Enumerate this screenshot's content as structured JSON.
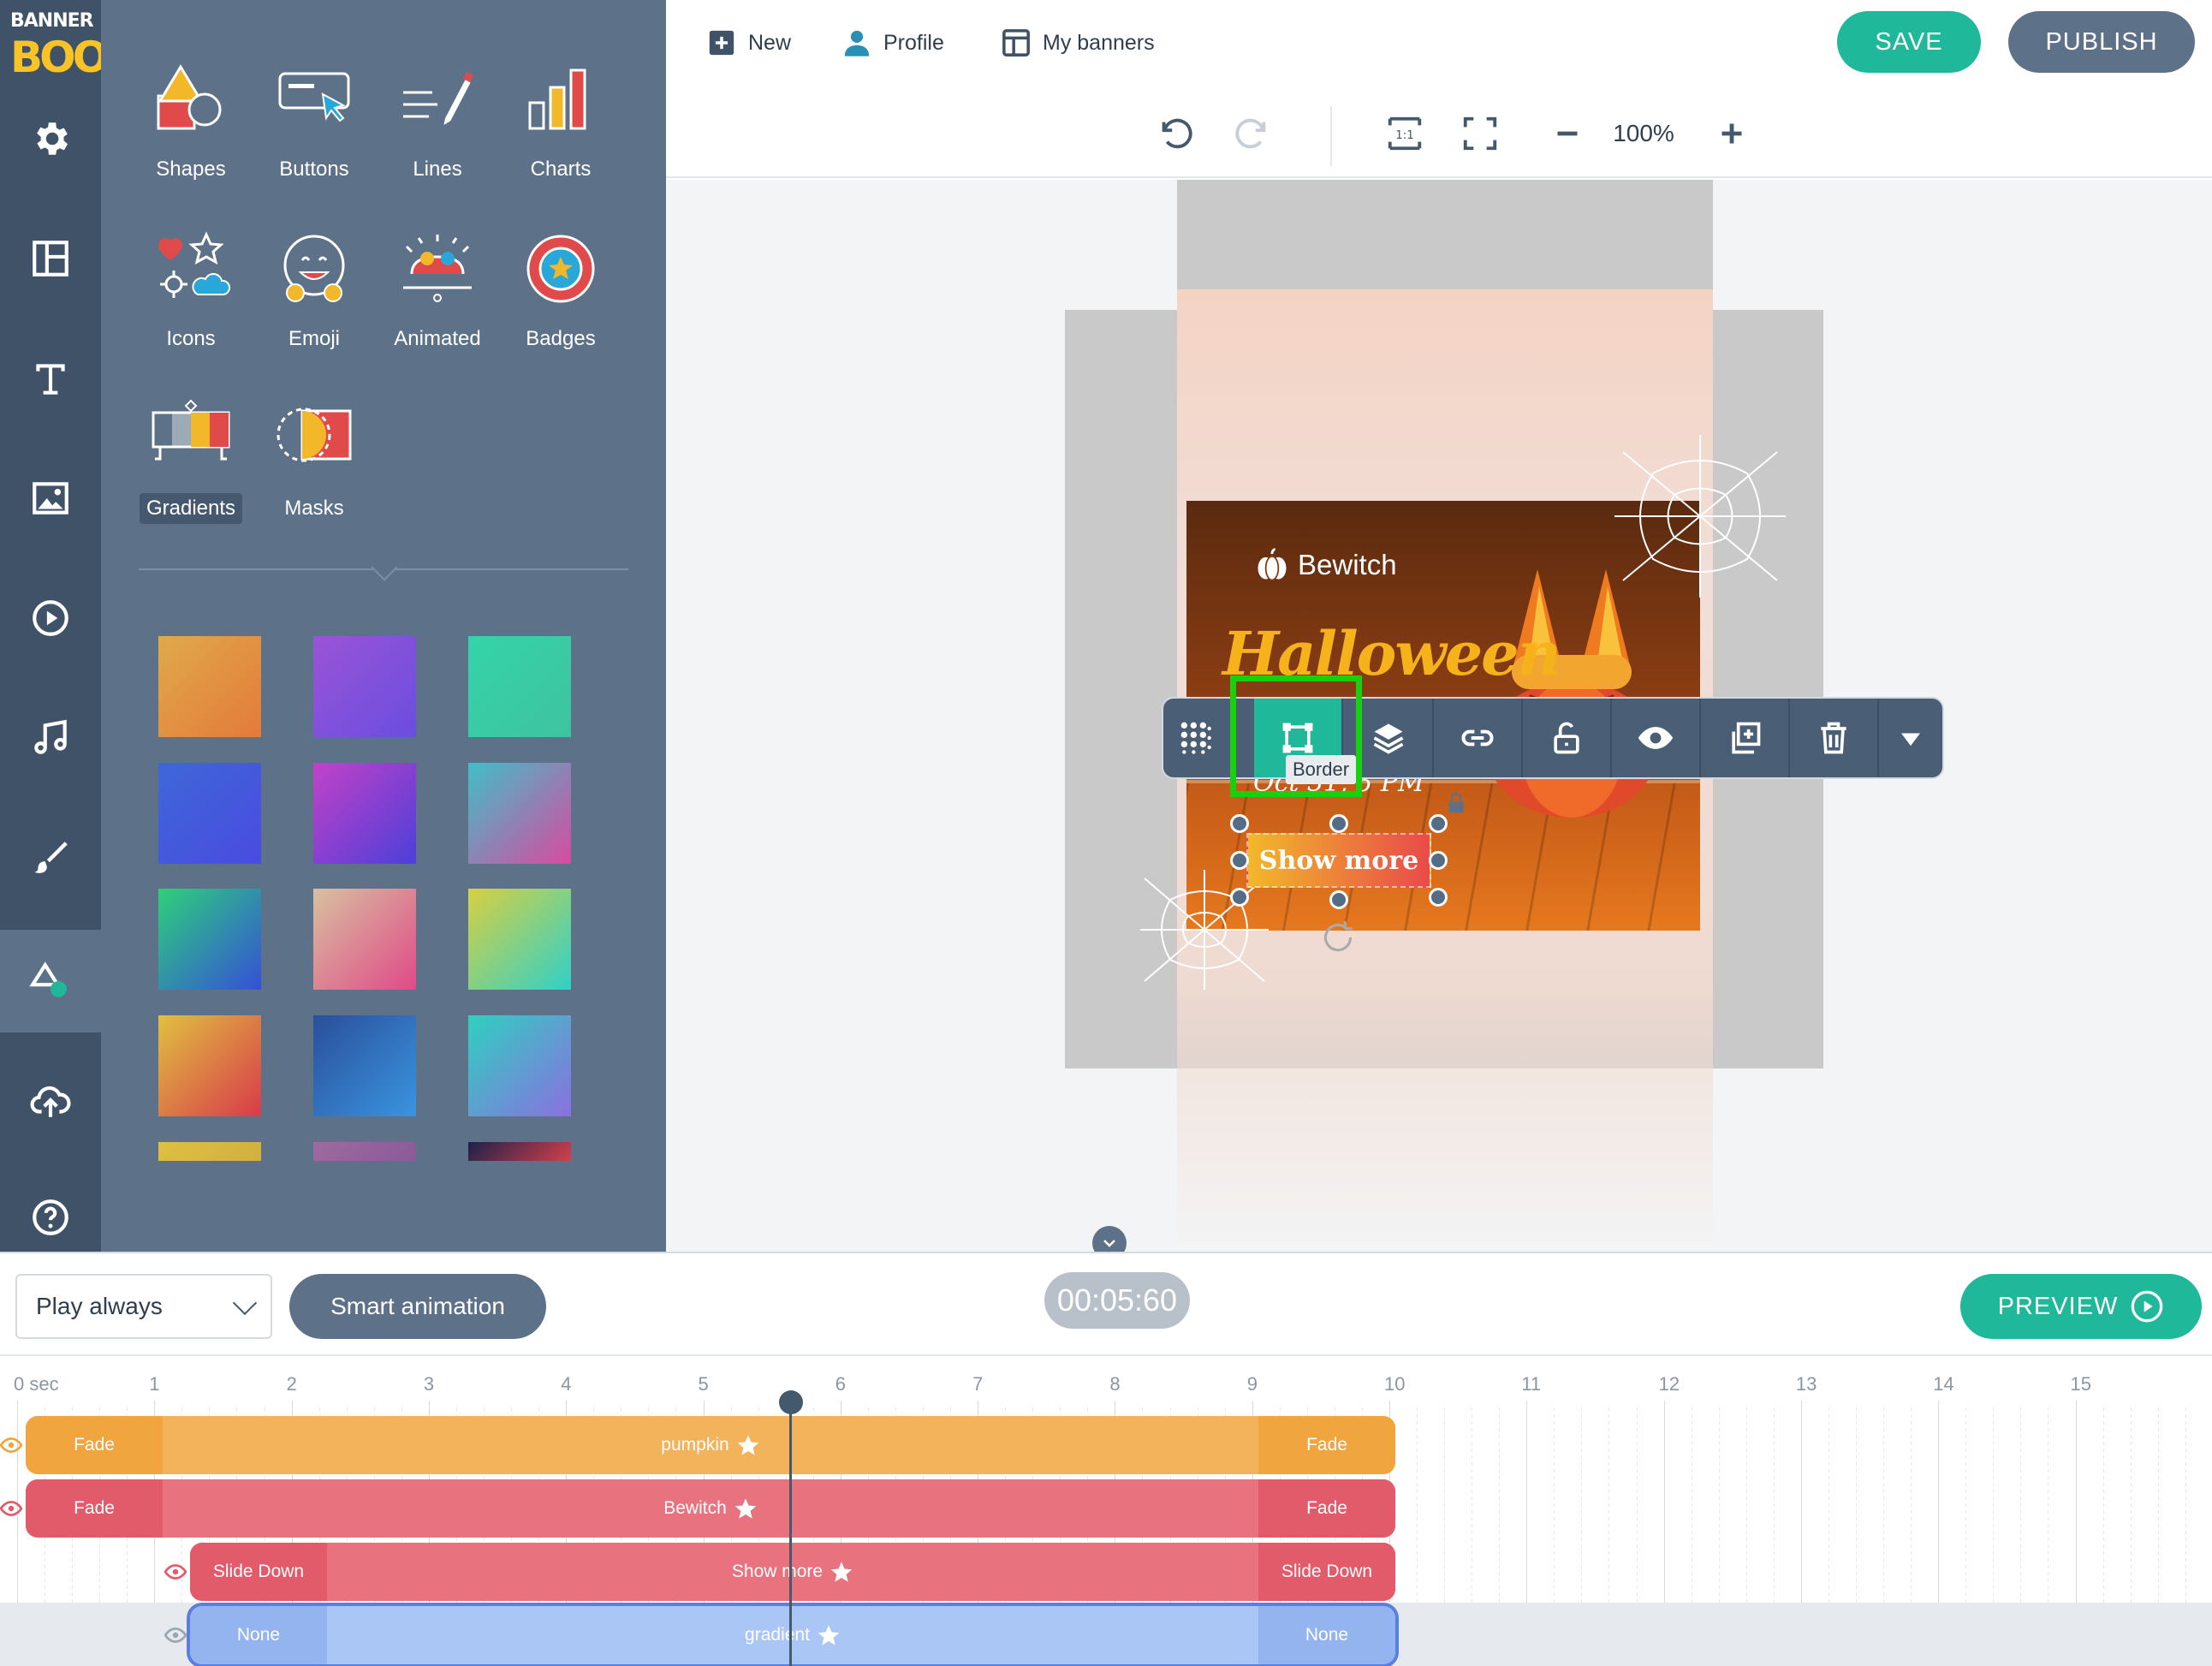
{
  "brand": {
    "line1": "BANNER",
    "line2": "BOO"
  },
  "rail": [
    "gear-icon",
    "layout-icon",
    "text-icon",
    "image-icon",
    "video-icon",
    "music-icon",
    "brush-icon",
    "elements-icon",
    "upload-icon",
    "help-icon"
  ],
  "panel": {
    "elements": [
      {
        "label": "Shapes"
      },
      {
        "label": "Buttons"
      },
      {
        "label": "Lines"
      },
      {
        "label": "Charts"
      },
      {
        "label": "Icons"
      },
      {
        "label": "Emoji"
      },
      {
        "label": "Animated"
      },
      {
        "label": "Badges"
      },
      {
        "label": "Gradients",
        "selected": true
      },
      {
        "label": "Masks"
      }
    ],
    "gradients": [
      [
        "#e0a94a",
        "#e37a3a"
      ],
      [
        "#9a54d6",
        "#6a4ee0"
      ],
      [
        "#34d4a8",
        "#3fc3a0"
      ],
      [
        "#3e67d8",
        "#4a4be0"
      ],
      [
        "#c242c8",
        "#4c3fd8"
      ],
      [
        "#3fbfc8",
        "#d84aa0"
      ],
      [
        "#2ed07a",
        "#3550d8"
      ],
      [
        "#d8c0a0",
        "#e04a88"
      ],
      [
        "#d8d040",
        "#30d0c8"
      ],
      [
        "#e0c040",
        "#d83a4a"
      ],
      [
        "#2a4f9a",
        "#3a94e0"
      ],
      [
        "#2fd0c0",
        "#8a70e0"
      ],
      [
        "#e0c040",
        "#d0b040"
      ],
      [
        "#a06aa0",
        "#8a5a9a"
      ],
      [
        "#20204a",
        "#d0404a"
      ]
    ]
  },
  "topbar": {
    "new": "New",
    "profile": "Profile",
    "my_banners": "My banners",
    "save": "SAVE",
    "publish": "PUBLISH"
  },
  "canvas_toolbar": {
    "zoom": "100%",
    "one_to_one": "1:1"
  },
  "banner": {
    "brand": "Bewitch",
    "headline": "Halloween",
    "date": "Oct 31, 5 PM",
    "cta": "Show more"
  },
  "element_toolbar": {
    "tooltip": "Border"
  },
  "bottom": {
    "play_mode": "Play always",
    "smart_animation": "Smart animation",
    "timer": "00:05:60",
    "preview": "PREVIEW"
  },
  "timeline": {
    "ruler": [
      "0 sec",
      "1",
      "2",
      "3",
      "4",
      "5",
      "6",
      "7",
      "8",
      "9",
      "10",
      "11",
      "12",
      "13",
      "14",
      "15"
    ],
    "tracks": [
      {
        "name": "pumpkin",
        "in": "Fade",
        "out": "Fade",
        "color": "#f2b35b",
        "edge": "#f0a53e"
      },
      {
        "name": "Bewitch",
        "in": "Fade",
        "out": "Fade",
        "color": "#e8737f",
        "edge": "#e25b6a"
      },
      {
        "name": "Show more",
        "in": "Slide Down",
        "out": "Slide Down",
        "color": "#e8737f",
        "edge": "#e25b6a"
      },
      {
        "name": "gradient",
        "in": "None",
        "out": "None",
        "color": "#a9c6f5",
        "edge": "#93b4ee"
      }
    ]
  }
}
